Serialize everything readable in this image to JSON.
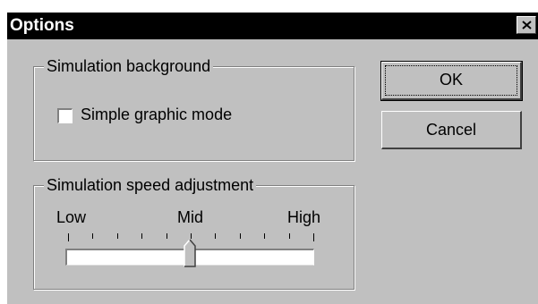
{
  "window": {
    "title": "Options",
    "close_glyph": "×"
  },
  "background_group": {
    "legend": "Simulation background",
    "checkbox_label": "Simple graphic mode",
    "checkbox_checked": false
  },
  "speed_group": {
    "legend": "Simulation speed adjustment",
    "labels": {
      "low": "Low",
      "mid": "Mid",
      "high": "High"
    },
    "slider_value": 0.5,
    "tick_count": 11
  },
  "buttons": {
    "ok_label": "OK",
    "cancel_label": "Cancel"
  },
  "colors": {
    "face": "#c0c0c0",
    "titlebar": "#000000",
    "title_text": "#ffffff"
  }
}
